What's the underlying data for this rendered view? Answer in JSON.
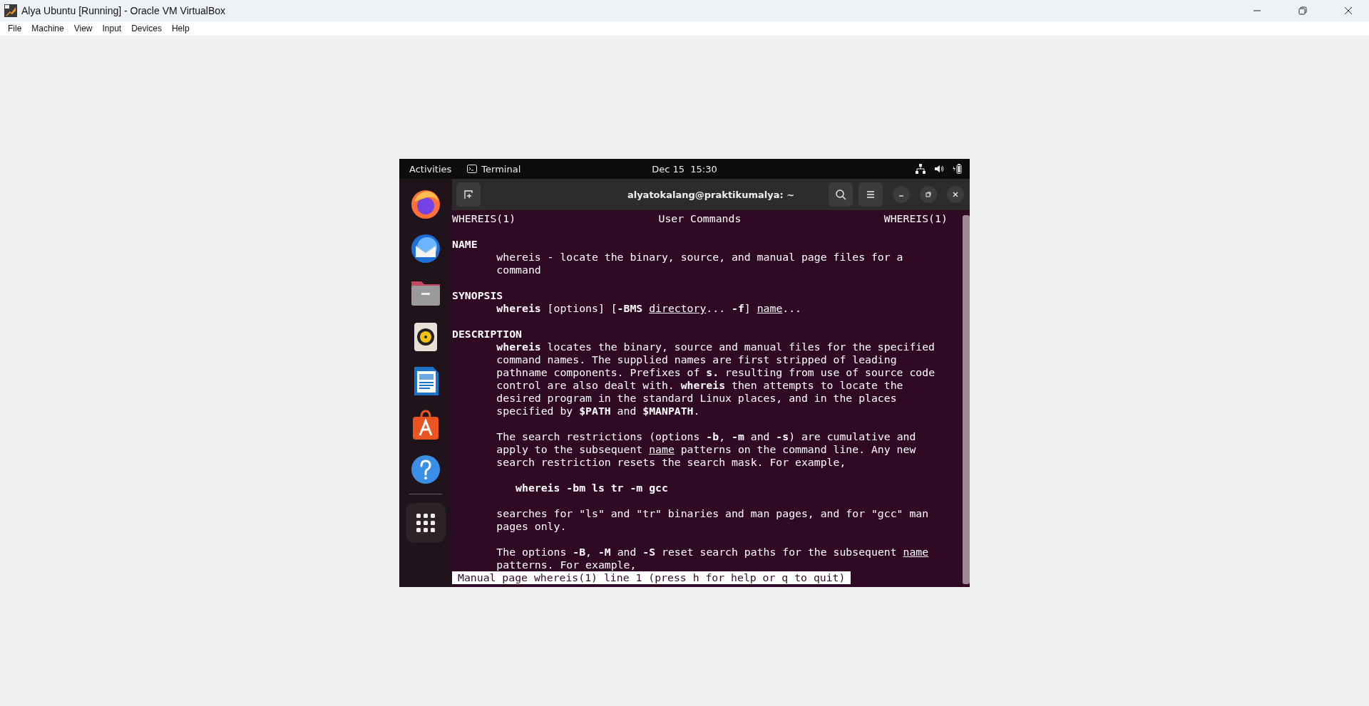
{
  "window": {
    "title": "Alya Ubuntu [Running] - Oracle VM VirtualBox"
  },
  "menu": [
    "File",
    "Machine",
    "View",
    "Input",
    "Devices",
    "Help"
  ],
  "guest": {
    "top_bar": {
      "activities": "Activities",
      "app": "Terminal",
      "clock": "Dec 15  15:30"
    },
    "dock": [
      {
        "kind": "browser"
      },
      {
        "kind": "mail"
      },
      {
        "kind": "files"
      },
      {
        "kind": "music"
      },
      {
        "kind": "writer"
      },
      {
        "kind": "store"
      },
      {
        "kind": "help"
      },
      {
        "kind": "separator"
      },
      {
        "kind": "grid"
      }
    ],
    "terminal": {
      "title": "alyatokalang@praktikumalya: ~",
      "header": {
        "left": "WHEREIS(1)",
        "center": "User Commands",
        "right": "WHEREIS(1)"
      },
      "lines": [
        {
          "kind": "blank"
        },
        {
          "kind": "heading",
          "text": "NAME"
        },
        {
          "kind": "body",
          "text": "whereis - locate the binary, source, and manual page files for a"
        },
        {
          "kind": "body",
          "text": "command"
        },
        {
          "kind": "blank"
        },
        {
          "kind": "heading",
          "text": "SYNOPSIS"
        },
        {
          "kind": "body",
          "text": "**whereis** [options] [**-BMS** *directory*... **-f**] *name*..."
        },
        {
          "kind": "blank"
        },
        {
          "kind": "heading",
          "text": "DESCRIPTION"
        },
        {
          "kind": "body",
          "text": "**whereis** locates the binary, source and manual files for the specified"
        },
        {
          "kind": "body",
          "text": "command names. The supplied names are first stripped of leading"
        },
        {
          "kind": "body",
          "text": "pathname components. Prefixes of **s.** resulting from use of source code"
        },
        {
          "kind": "body",
          "text": "control are also dealt with. **whereis** then attempts to locate the"
        },
        {
          "kind": "body",
          "text": "desired program in the standard Linux places, and in the places"
        },
        {
          "kind": "body",
          "text": "specified by **$PATH** and **$MANPATH**."
        },
        {
          "kind": "blank"
        },
        {
          "kind": "body",
          "text": "The search restrictions (options **-b**, **-m** and **-s**) are cumulative and"
        },
        {
          "kind": "body",
          "text": "apply to the subsequent *name* patterns on the command line. Any new"
        },
        {
          "kind": "body",
          "text": "search restriction resets the search mask. For example,"
        },
        {
          "kind": "blank"
        },
        {
          "kind": "example",
          "text": "whereis -bm ls tr -m gcc"
        },
        {
          "kind": "blank"
        },
        {
          "kind": "body",
          "text": "searches for \"ls\" and \"tr\" binaries and man pages, and for \"gcc\" man"
        },
        {
          "kind": "body",
          "text": "pages only."
        },
        {
          "kind": "blank"
        },
        {
          "kind": "body",
          "text": "The options **-B**, **-M** and **-S** reset search paths for the subsequent *name*"
        },
        {
          "kind": "body",
          "text": "patterns. For example,"
        }
      ],
      "status": "Manual page whereis(1) line 1 (press h for help or q to quit)"
    }
  }
}
